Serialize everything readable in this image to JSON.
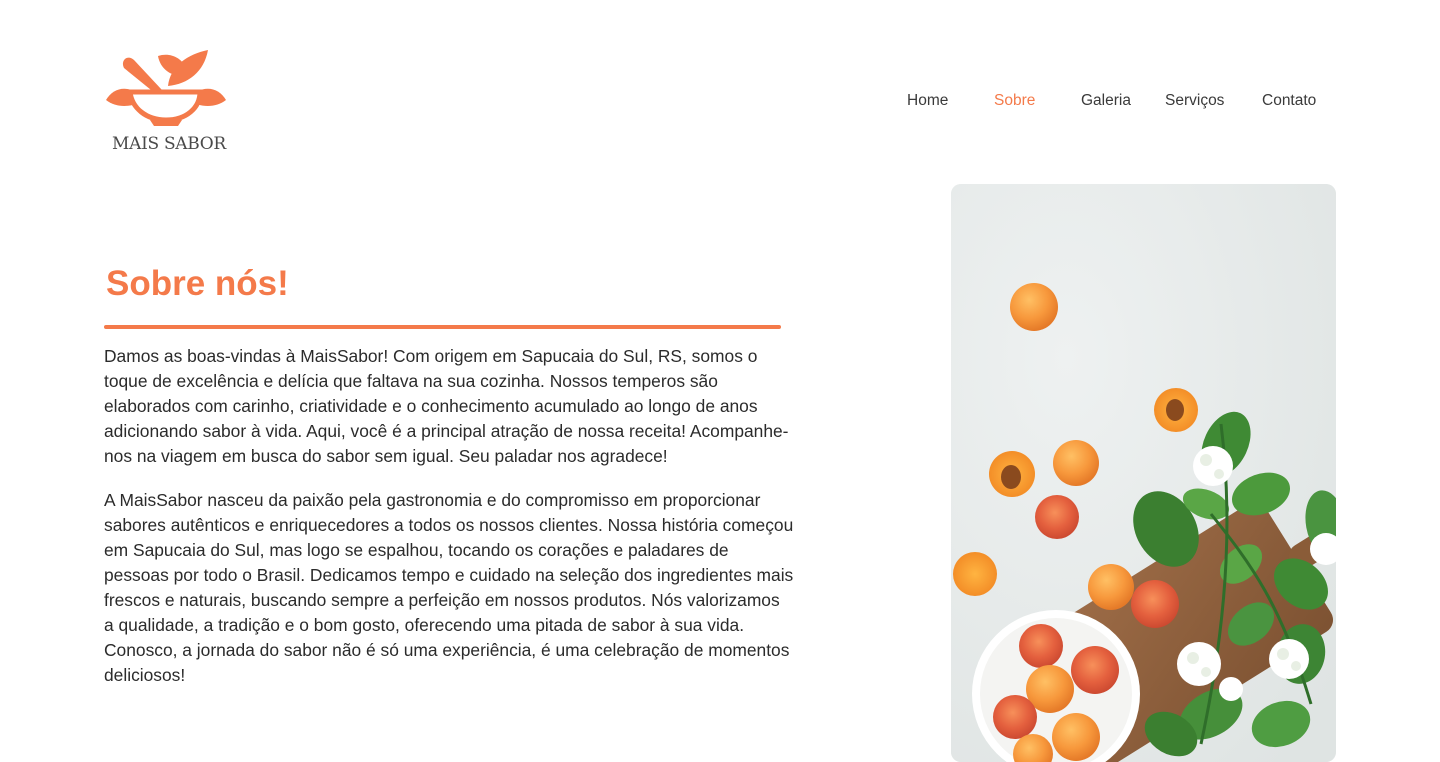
{
  "brand": {
    "name": "MAIS SABOR",
    "accent_color": "#f47a4a",
    "logo_icon": "mortar-and-pestle-with-leaves-logo"
  },
  "nav": {
    "items": [
      {
        "label": "Home",
        "active": false
      },
      {
        "label": "Sobre",
        "active": true
      },
      {
        "label": "Galeria",
        "active": false
      },
      {
        "label": "Serviços",
        "active": false
      },
      {
        "label": "Contato",
        "active": false
      }
    ]
  },
  "about": {
    "title": "Sobre nós!",
    "paragraphs": [
      "Damos as boas-vindas à MaisSabor! Com origem em Sapucaia do Sul, RS, somos o toque de excelência e delícia que faltava na sua cozinha. Nossos temperos são elaborados com carinho, criatividade e o conhecimento acumulado ao longo de anos adicionando sabor à vida. Aqui, você é a principal atração de nossa receita! Acompanhe-nos na viagem em busca do sabor sem igual. Seu paladar nos agradece!",
      "A MaisSabor nasceu da paixão pela gastronomia e do compromisso em proporcionar sabores autênticos e enriquecedores a todos os nossos clientes. Nossa história começou em Sapucaia do Sul, mas logo se espalhou, tocando os corações e paladares de pessoas por todo o Brasil. Dedicamos tempo e cuidado na seleção dos ingredientes mais frescos e naturais, buscando sempre a perfeição em nossos produtos. Nós valorizamos a qualidade, a tradição e o bom gosto, oferecendo uma pitada de sabor à sua vida. Conosco, a jornada do sabor não é só uma experiência, é uma celebração de momentos deliciosos!"
    ]
  },
  "hero_image": {
    "subject": "apricots-bowl-cutting-board-photo"
  }
}
